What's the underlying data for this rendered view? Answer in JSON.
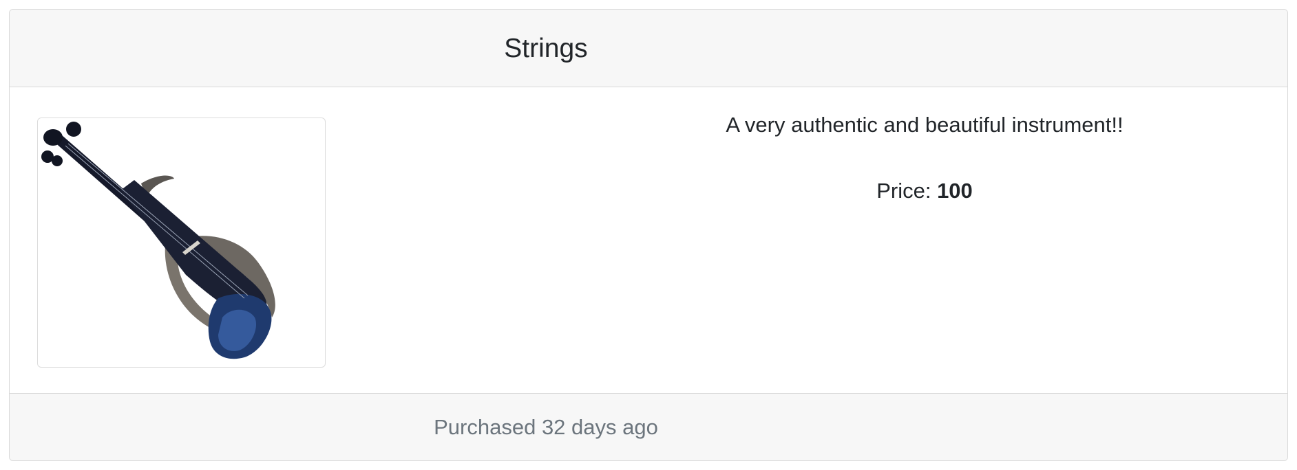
{
  "product": {
    "title": "Strings",
    "image_alt": "electric violin",
    "description": "A very authentic and beautiful instrument!!",
    "price_label": "Price:",
    "price_value": "100",
    "purchase_info": "Purchased 32 days ago"
  },
  "colors": {
    "header_bg": "#f7f7f7",
    "border": "#d9d9d9",
    "muted_text": "#6c757d",
    "text": "#212529"
  }
}
